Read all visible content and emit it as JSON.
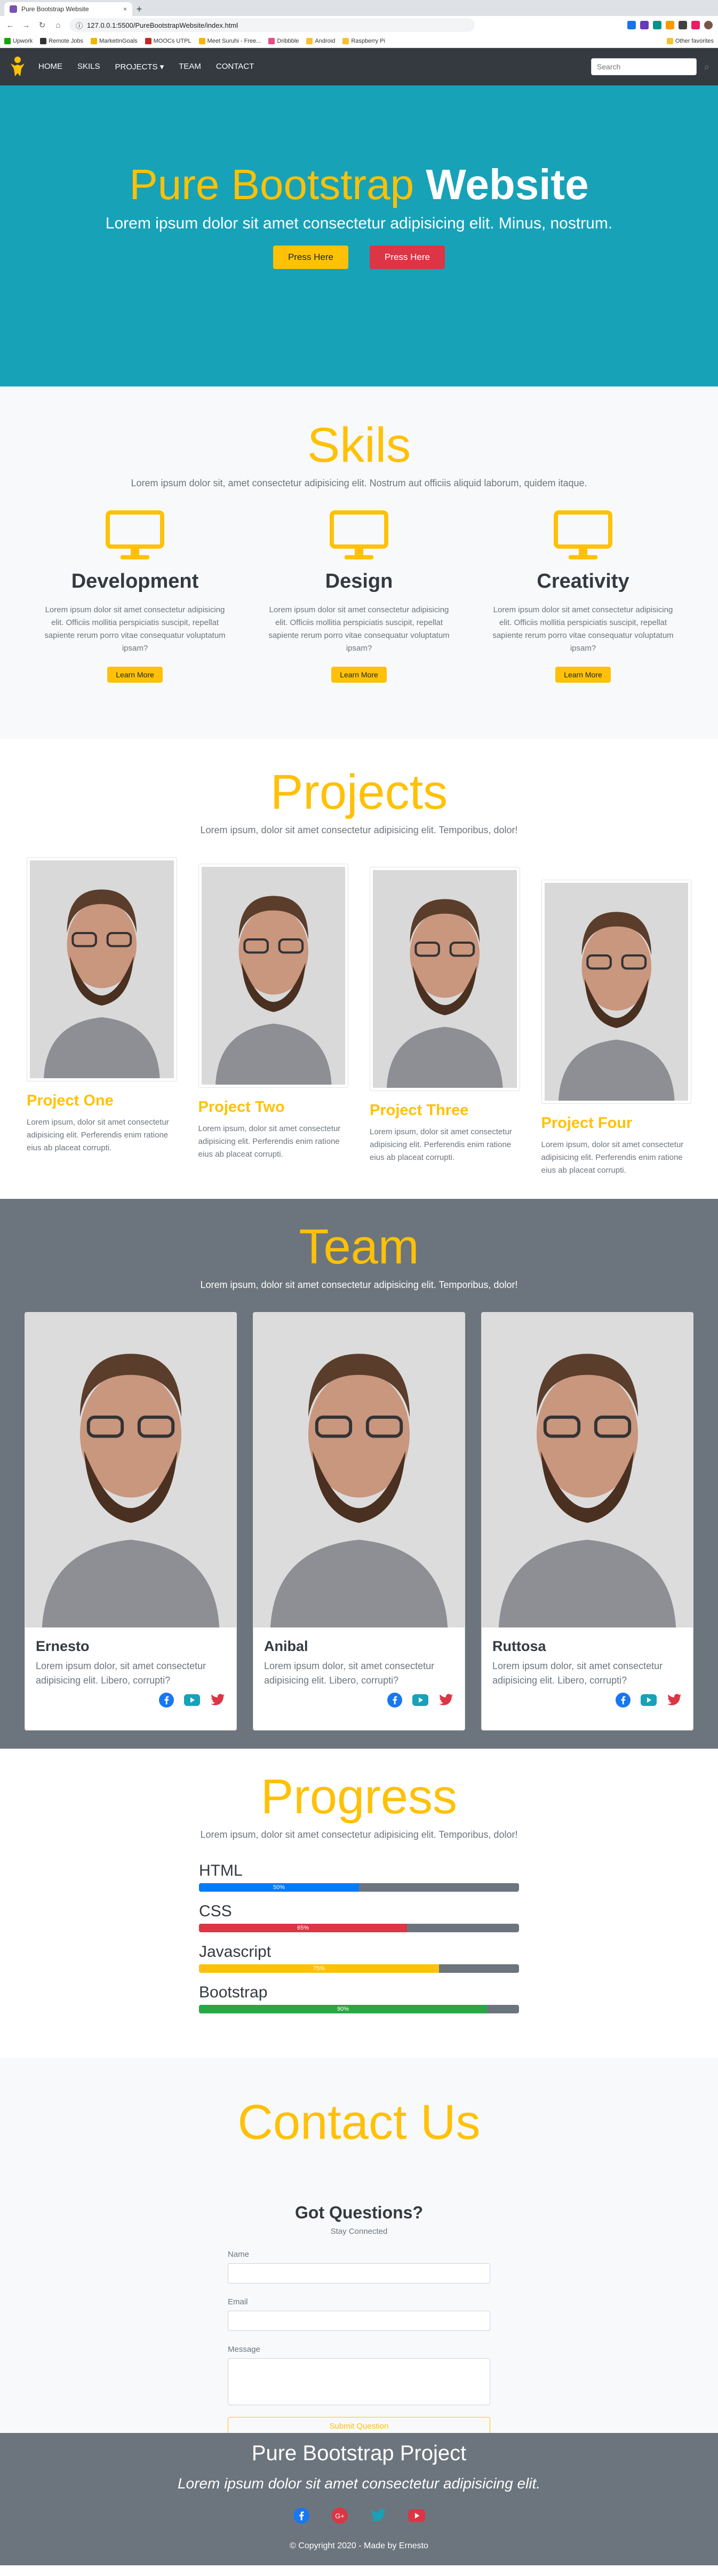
{
  "browser": {
    "tab_title": "Pure Bootstrap Website",
    "new_tab": "+",
    "close": "×",
    "url": "127.0.0.1:5500/PureBootstrapWebsite/index.html",
    "bookmarks": [
      "Upwork",
      "Remote Jobs",
      "MarketInGoals",
      "MOOCs UTPL",
      "Meet Suruhi - Free...",
      "Dribbble",
      "Android",
      "Raspberry Pi"
    ],
    "other_favorites": "Other favorites"
  },
  "nav": {
    "links": [
      "HOME",
      "SKILS",
      "PROJECTS ▾",
      "TEAM",
      "CONTACT"
    ],
    "search_placeholder": "Search",
    "search_icon": "⌕"
  },
  "hero": {
    "title_light": "Pure Bootstrap ",
    "title_bold": "Website",
    "lead": "Lorem ipsum dolor sit amet consectetur adipisicing elit. Minus, nostrum.",
    "btn1": "Press Here",
    "btn2": "Press Here"
  },
  "skills": {
    "title": "Skils",
    "subtitle": "Lorem ipsum dolor sit, amet consectetur adipisicing elit. Nostrum aut officiis aliquid laborum, quidem itaque.",
    "items": [
      {
        "heading": "Development",
        "text": "Lorem ipsum dolor sit amet consectetur adipisicing elit. Officiis mollitia perspiciatis suscipit, repellat sapiente rerum porro vitae consequatur voluptatum ipsam?",
        "button": "Learn More"
      },
      {
        "heading": "Design",
        "text": "Lorem ipsum dolor sit amet consectetur adipisicing elit. Officiis mollitia perspiciatis suscipit, repellat sapiente rerum porro vitae consequatur voluptatum ipsam?",
        "button": "Learn More"
      },
      {
        "heading": "Creativity",
        "text": "Lorem ipsum dolor sit amet consectetur adipisicing elit. Officiis mollitia perspiciatis suscipit, repellat sapiente rerum porro vitae consequatur voluptatum ipsam?",
        "button": "Learn More"
      }
    ]
  },
  "projects": {
    "title": "Projects",
    "subtitle": "Lorem ipsum, dolor sit amet consectetur adipisicing elit. Temporibus, dolor!",
    "items": [
      {
        "title": "Project One",
        "text": "Lorem ipsum, dolor sit amet consectetur adipisicing elit. Perferendis enim ratione eius ab placeat corrupti."
      },
      {
        "title": "Project Two",
        "text": "Lorem ipsum, dolor sit amet consectetur adipisicing elit. Perferendis enim ratione eius ab placeat corrupti."
      },
      {
        "title": "Project Three",
        "text": "Lorem ipsum, dolor sit amet consectetur adipisicing elit. Perferendis enim ratione eius ab placeat corrupti."
      },
      {
        "title": "Project Four",
        "text": "Lorem ipsum, dolor sit amet consectetur adipisicing elit. Perferendis enim ratione eius ab placeat corrupti."
      }
    ]
  },
  "team": {
    "title": "Team",
    "subtitle": "Lorem ipsum, dolor sit amet consectetur adipisicing elit. Temporibus, dolor!",
    "members": [
      {
        "name": "Ernesto",
        "text": "Lorem ipsum dolor, sit amet consectetur adipisicing elit. Libero, corrupti?"
      },
      {
        "name": "Anibal",
        "text": "Lorem ipsum dolor, sit amet consectetur adipisicing elit. Libero, corrupti?"
      },
      {
        "name": "Ruttosa",
        "text": "Lorem ipsum dolor, sit amet consectetur adipisicing elit. Libero, corrupti?"
      }
    ]
  },
  "progress": {
    "title": "Progress",
    "subtitle": "Lorem ipsum, dolor sit amet consectetur adipisicing elit. Temporibus, dolor!",
    "bars": [
      {
        "label": "HTML",
        "value": 50,
        "text": "50%",
        "color": "#007bff"
      },
      {
        "label": "CSS",
        "value": 65,
        "text": "65%",
        "color": "#dc3545"
      },
      {
        "label": "Javascript",
        "value": 75,
        "text": "75%",
        "color": "#ffc107"
      },
      {
        "label": "Bootstrap",
        "value": 90,
        "text": "90%",
        "color": "#28a745"
      }
    ]
  },
  "contact": {
    "title": "Contact Us",
    "form_heading": "Got Questions?",
    "form_sub": "Stay Connected",
    "name_label": "Name",
    "email_label": "Email",
    "message_label": "Message",
    "submit": "Submit Question"
  },
  "footer": {
    "title": "Pure Bootstrap Project",
    "tagline": "Lorem ipsum dolor sit amet consectetur adipisicing elit.",
    "copyright": "© Copyright 2020 - Made by Ernesto"
  },
  "colors": {
    "accent": "#ffc107",
    "hero_bg": "#17a2b8",
    "dark": "#343a40",
    "gray": "#6c757d",
    "danger": "#dc3545"
  }
}
